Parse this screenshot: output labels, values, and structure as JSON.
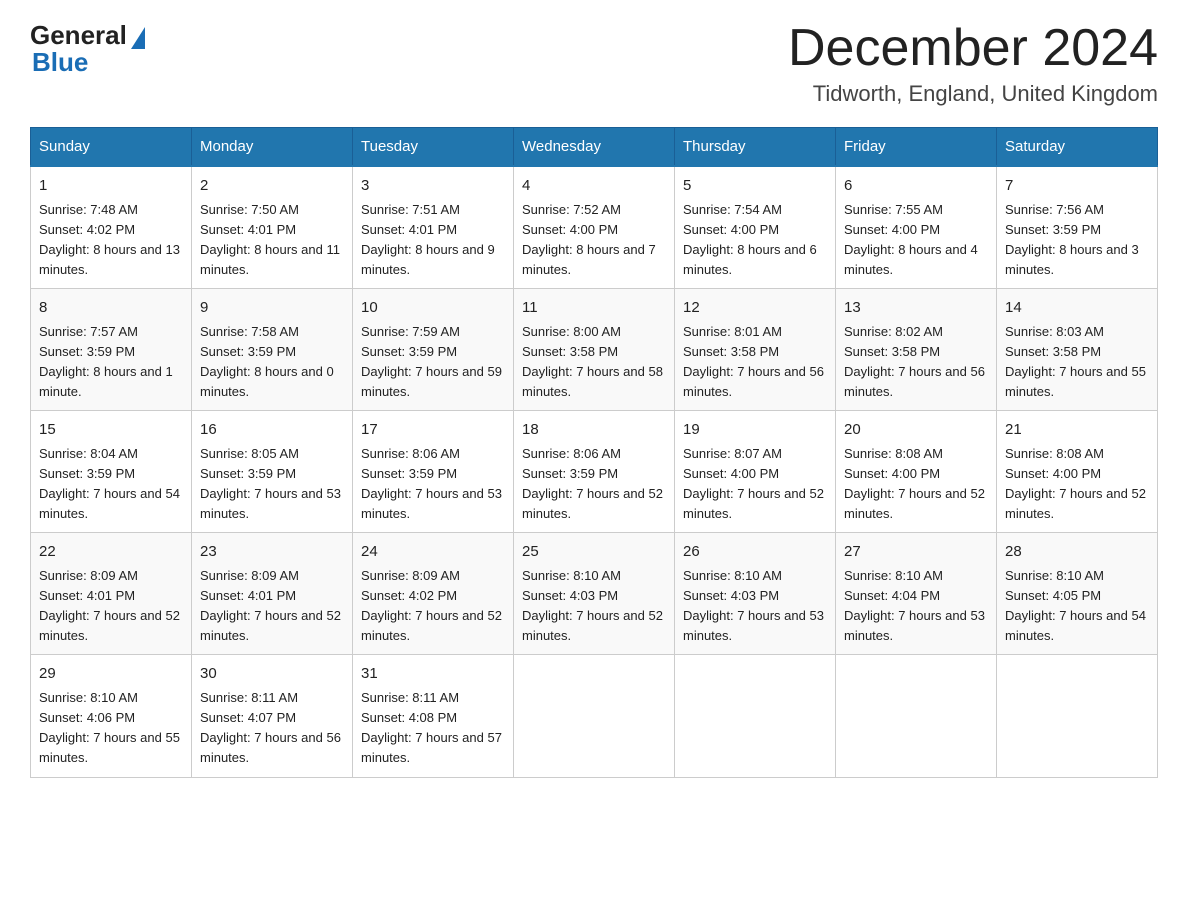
{
  "header": {
    "logo_general": "General",
    "logo_blue": "Blue",
    "month_title": "December 2024",
    "subtitle": "Tidworth, England, United Kingdom"
  },
  "days_of_week": [
    "Sunday",
    "Monday",
    "Tuesday",
    "Wednesday",
    "Thursday",
    "Friday",
    "Saturday"
  ],
  "weeks": [
    [
      {
        "day": "1",
        "sunrise": "7:48 AM",
        "sunset": "4:02 PM",
        "daylight": "8 hours and 13 minutes."
      },
      {
        "day": "2",
        "sunrise": "7:50 AM",
        "sunset": "4:01 PM",
        "daylight": "8 hours and 11 minutes."
      },
      {
        "day": "3",
        "sunrise": "7:51 AM",
        "sunset": "4:01 PM",
        "daylight": "8 hours and 9 minutes."
      },
      {
        "day": "4",
        "sunrise": "7:52 AM",
        "sunset": "4:00 PM",
        "daylight": "8 hours and 7 minutes."
      },
      {
        "day": "5",
        "sunrise": "7:54 AM",
        "sunset": "4:00 PM",
        "daylight": "8 hours and 6 minutes."
      },
      {
        "day": "6",
        "sunrise": "7:55 AM",
        "sunset": "4:00 PM",
        "daylight": "8 hours and 4 minutes."
      },
      {
        "day": "7",
        "sunrise": "7:56 AM",
        "sunset": "3:59 PM",
        "daylight": "8 hours and 3 minutes."
      }
    ],
    [
      {
        "day": "8",
        "sunrise": "7:57 AM",
        "sunset": "3:59 PM",
        "daylight": "8 hours and 1 minute."
      },
      {
        "day": "9",
        "sunrise": "7:58 AM",
        "sunset": "3:59 PM",
        "daylight": "8 hours and 0 minutes."
      },
      {
        "day": "10",
        "sunrise": "7:59 AM",
        "sunset": "3:59 PM",
        "daylight": "7 hours and 59 minutes."
      },
      {
        "day": "11",
        "sunrise": "8:00 AM",
        "sunset": "3:58 PM",
        "daylight": "7 hours and 58 minutes."
      },
      {
        "day": "12",
        "sunrise": "8:01 AM",
        "sunset": "3:58 PM",
        "daylight": "7 hours and 56 minutes."
      },
      {
        "day": "13",
        "sunrise": "8:02 AM",
        "sunset": "3:58 PM",
        "daylight": "7 hours and 56 minutes."
      },
      {
        "day": "14",
        "sunrise": "8:03 AM",
        "sunset": "3:58 PM",
        "daylight": "7 hours and 55 minutes."
      }
    ],
    [
      {
        "day": "15",
        "sunrise": "8:04 AM",
        "sunset": "3:59 PM",
        "daylight": "7 hours and 54 minutes."
      },
      {
        "day": "16",
        "sunrise": "8:05 AM",
        "sunset": "3:59 PM",
        "daylight": "7 hours and 53 minutes."
      },
      {
        "day": "17",
        "sunrise": "8:06 AM",
        "sunset": "3:59 PM",
        "daylight": "7 hours and 53 minutes."
      },
      {
        "day": "18",
        "sunrise": "8:06 AM",
        "sunset": "3:59 PM",
        "daylight": "7 hours and 52 minutes."
      },
      {
        "day": "19",
        "sunrise": "8:07 AM",
        "sunset": "4:00 PM",
        "daylight": "7 hours and 52 minutes."
      },
      {
        "day": "20",
        "sunrise": "8:08 AM",
        "sunset": "4:00 PM",
        "daylight": "7 hours and 52 minutes."
      },
      {
        "day": "21",
        "sunrise": "8:08 AM",
        "sunset": "4:00 PM",
        "daylight": "7 hours and 52 minutes."
      }
    ],
    [
      {
        "day": "22",
        "sunrise": "8:09 AM",
        "sunset": "4:01 PM",
        "daylight": "7 hours and 52 minutes."
      },
      {
        "day": "23",
        "sunrise": "8:09 AM",
        "sunset": "4:01 PM",
        "daylight": "7 hours and 52 minutes."
      },
      {
        "day": "24",
        "sunrise": "8:09 AM",
        "sunset": "4:02 PM",
        "daylight": "7 hours and 52 minutes."
      },
      {
        "day": "25",
        "sunrise": "8:10 AM",
        "sunset": "4:03 PM",
        "daylight": "7 hours and 52 minutes."
      },
      {
        "day": "26",
        "sunrise": "8:10 AM",
        "sunset": "4:03 PM",
        "daylight": "7 hours and 53 minutes."
      },
      {
        "day": "27",
        "sunrise": "8:10 AM",
        "sunset": "4:04 PM",
        "daylight": "7 hours and 53 minutes."
      },
      {
        "day": "28",
        "sunrise": "8:10 AM",
        "sunset": "4:05 PM",
        "daylight": "7 hours and 54 minutes."
      }
    ],
    [
      {
        "day": "29",
        "sunrise": "8:10 AM",
        "sunset": "4:06 PM",
        "daylight": "7 hours and 55 minutes."
      },
      {
        "day": "30",
        "sunrise": "8:11 AM",
        "sunset": "4:07 PM",
        "daylight": "7 hours and 56 minutes."
      },
      {
        "day": "31",
        "sunrise": "8:11 AM",
        "sunset": "4:08 PM",
        "daylight": "7 hours and 57 minutes."
      },
      null,
      null,
      null,
      null
    ]
  ]
}
